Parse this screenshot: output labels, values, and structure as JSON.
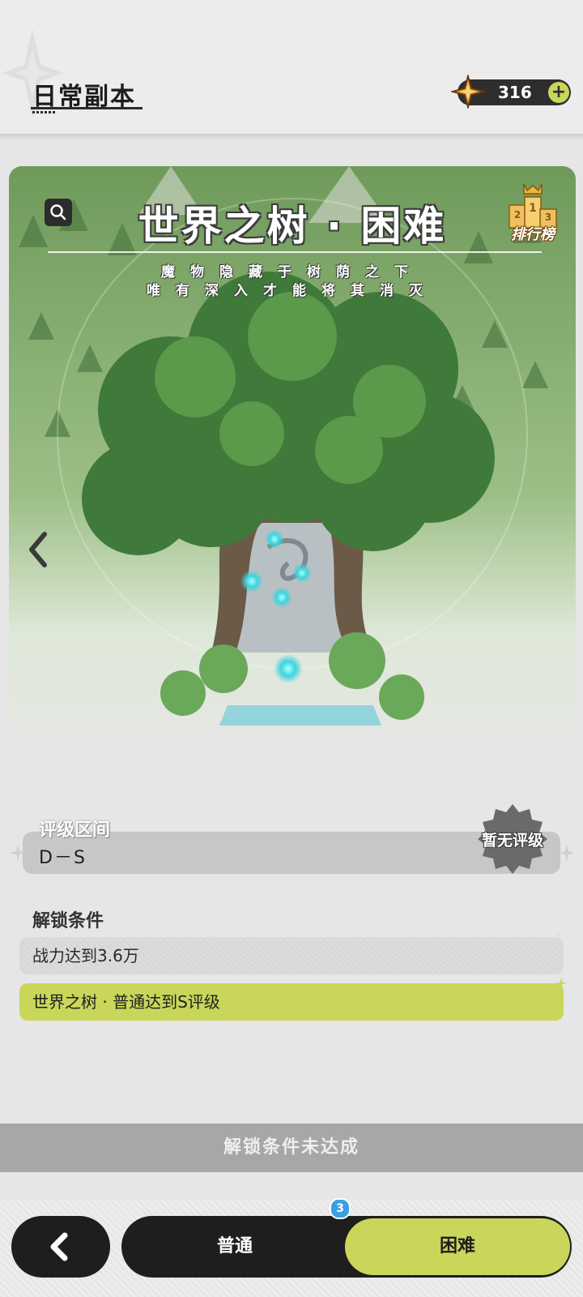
{
  "header": {
    "title": "日常副本",
    "currency": {
      "icon": "crystal-star-icon",
      "amount": "316",
      "add_icon": "plus-icon"
    }
  },
  "stage": {
    "title": "世界之树 · 困难",
    "description_line1": "魔物隐藏于树荫之下",
    "description_line2": "唯有深入才能将其消灭",
    "ranking_label": "排行榜",
    "ranking_digits": [
      "2",
      "1",
      "3"
    ],
    "search_icon": "search-icon",
    "prev_icon": "chevron-left-icon"
  },
  "rating": {
    "label": "评级区间",
    "value": "D－S",
    "badge": "暂无评级"
  },
  "unlock": {
    "title": "解锁条件",
    "conditions": [
      "战力达到3.6万",
      "世界之树 · 普通达到S评级"
    ]
  },
  "status": {
    "text": "解锁条件未达成"
  },
  "nav": {
    "back_icon": "back-arrow-icon",
    "tab_normal": "普通",
    "tab_hard": "困难",
    "normal_badge": "3"
  },
  "colors": {
    "accent": "#c9d65a",
    "dark": "#1e1e1e",
    "status_bar": "#a7a7a7"
  }
}
